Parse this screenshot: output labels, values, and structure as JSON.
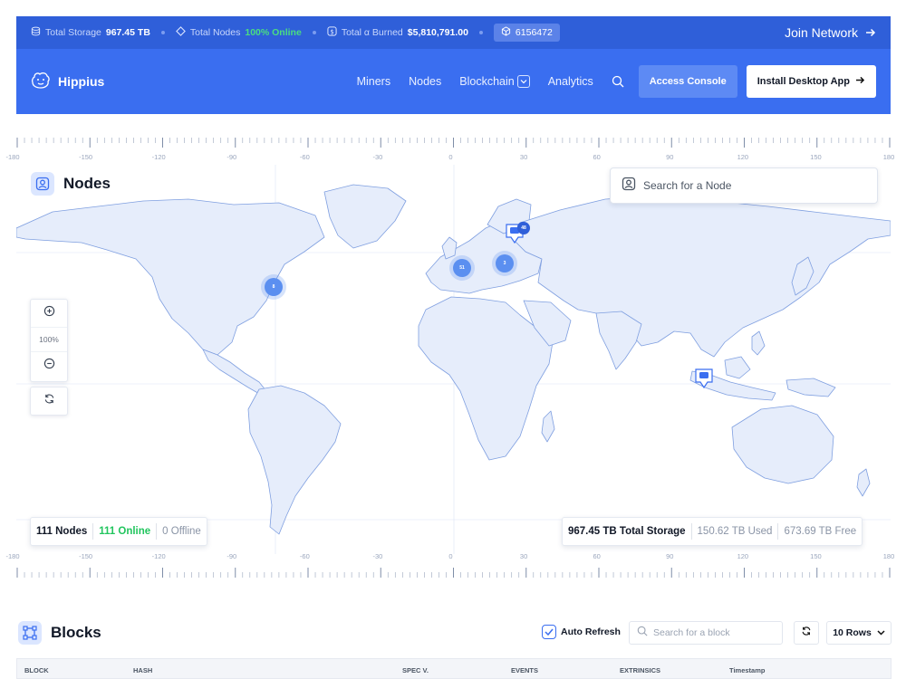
{
  "topbar": {
    "storage_label": "Total Storage",
    "storage_value": "967.45 TB",
    "nodes_label": "Total Nodes",
    "nodes_value": "100% Online",
    "burned_label": "Total α Burned",
    "burned_value": "$5,810,791.00",
    "block_number": "6156472",
    "join_label": "Join Network"
  },
  "nav": {
    "brand": "Hippius",
    "links": [
      "Miners",
      "Nodes",
      "Blockchain",
      "Analytics"
    ],
    "access_console": "Access Console",
    "install_app": "Install Desktop App"
  },
  "ruler": {
    "labels": [
      "-180",
      "-150",
      "-120",
      "-90",
      "-60",
      "-30",
      "0",
      "30",
      "60",
      "90",
      "120",
      "150",
      "180"
    ]
  },
  "map": {
    "title": "Nodes",
    "search_placeholder": "Search for a Node",
    "zoom_level": "100%",
    "clusters": [
      {
        "label": "8"
      },
      {
        "label": "51"
      },
      {
        "label": "3"
      },
      {
        "label": "48"
      }
    ],
    "summary": {
      "nodes": "111 Nodes",
      "online": "111 Online",
      "offline": "0 Offline"
    },
    "storage": {
      "total": "967.45 TB Total Storage",
      "used": "150.62 TB Used",
      "free": "673.69 TB Free"
    }
  },
  "blocks": {
    "title": "Blocks",
    "auto_refresh": "Auto Refresh",
    "search_placeholder": "Search for a block",
    "rows_label": "10 Rows",
    "columns": [
      "BLOCK",
      "HASH",
      "SPEC V.",
      "EVENTS",
      "EXTRINSICS",
      "Timestamp"
    ]
  },
  "colors": {
    "topbar_bg": "#2f5fd9",
    "navbar_bg": "#3a6ef0",
    "land": "#e6edfb",
    "land_stroke": "#7f9fe0",
    "online_green": "#22c55e",
    "cluster": "#5b8ff0"
  }
}
